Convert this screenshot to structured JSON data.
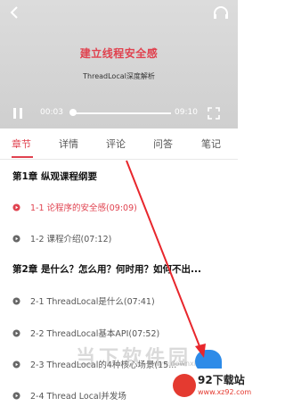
{
  "player": {
    "title": "建立线程安全感",
    "subtitle": "ThreadLocal深度解析",
    "time_current": "00:03",
    "time_total": "09:10",
    "progress": 0.005
  },
  "tabs": [
    {
      "label": "章节",
      "active": true
    },
    {
      "label": "详情",
      "active": false
    },
    {
      "label": "评论",
      "active": false
    },
    {
      "label": "问答",
      "active": false
    },
    {
      "label": "笔记",
      "active": false
    }
  ],
  "chapters": [
    {
      "title": "第1章 纵观课程纲要",
      "lessons": [
        {
          "label": "1-1 论程序的安全感(09:09)",
          "current": true
        },
        {
          "label": "1-2 课程介绍(07:12)",
          "current": false
        }
      ]
    },
    {
      "title": "第2章 是什么？怎么用？何时用？如何不出...",
      "lessons": [
        {
          "label": "2-1 ThreadLocal是什么(07:41)",
          "current": false
        },
        {
          "label": "2-2 ThreadLocal基本API(07:52)",
          "current": false
        },
        {
          "label": "2-3 ThreadLocal的4种核心场景(15...",
          "current": false
        },
        {
          "label": "2-4 Thread Local并发场",
          "current": false
        }
      ]
    }
  ],
  "watermark": {
    "text": "当下软件园",
    "tag": "www.downxia.com",
    "logo_text": "92下载站",
    "logo_url": "www.xz92.com"
  },
  "colors": {
    "accent": "#e0424f",
    "arrow": "#e8262c",
    "fab": "#2d8be8"
  }
}
